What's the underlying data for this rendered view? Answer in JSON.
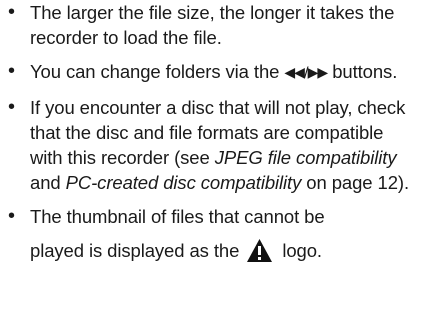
{
  "notes": [
    {
      "bullet": "•",
      "text": "The larger the file size, the longer it takes the recorder to load the file."
    },
    {
      "bullet": "•",
      "before": "You can change folders via the ",
      "arrows": "◀◀/▶▶",
      "after": " buttons."
    },
    {
      "bullet": "•",
      "part1": "If you encounter a disc that will not play, check that the disc and file formats are compatible with this recorder (see ",
      "ref1": "JPEG file compatibility",
      "part2": " and ",
      "ref2": "PC-created disc compatibility",
      "part3": " on page 12)."
    },
    {
      "bullet": "•",
      "line1": "The thumbnail of files that cannot be",
      "line2_before": "played is displayed as the",
      "line2_after": "logo.",
      "icon": "warning-triangle-icon"
    }
  ]
}
